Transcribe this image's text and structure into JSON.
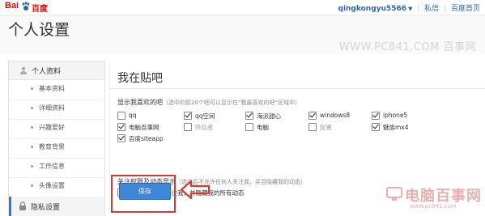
{
  "topbar": {
    "logo_text": "Bai",
    "logo_cn": "百度",
    "username": "qingkongyu5566",
    "links": [
      "私信",
      "百度首页"
    ]
  },
  "header": {
    "title": "个人设置",
    "watermark": "WWW.PC841.COM 百事网"
  },
  "sidebar": {
    "section": "个人资料",
    "items": [
      "基本资料",
      "详细资料",
      "兴趣爱好",
      "教育背景",
      "工作信息",
      "头像设置"
    ],
    "active": "隐私设置"
  },
  "main": {
    "section_title": "我在贴吧",
    "favorites": {
      "label": "显示我喜欢的吧",
      "hint": "（选中的前20个吧可以显示在“我最喜欢的吧”区域中）",
      "options": [
        {
          "label": "qq",
          "checked": false,
          "enabled": true
        },
        {
          "label": "qq空间",
          "checked": true,
          "enabled": true
        },
        {
          "label": "海派甜心",
          "checked": true,
          "enabled": true
        },
        {
          "label": "windows8",
          "checked": true,
          "enabled": true
        },
        {
          "label": "iphone5",
          "checked": true,
          "enabled": true
        },
        {
          "label": "电脑百事网",
          "checked": true,
          "enabled": true
        },
        {
          "label": "降临者",
          "checked": false,
          "enabled": false
        },
        {
          "label": "电脑",
          "checked": false,
          "enabled": true
        },
        {
          "label": "配置",
          "checked": false,
          "enabled": false
        },
        {
          "label": "魅族mx4",
          "checked": true,
          "enabled": true
        },
        {
          "label": "百度siteapp",
          "checked": true,
          "enabled": true
        }
      ]
    },
    "permissions": {
      "label": "关注权限及动态显示",
      "hint": "（选中后不允许任何人关注我，并且隐藏我的动态）",
      "option": "不允许任何人关注我，并隐藏我的所有动态",
      "checked": false
    },
    "save_label": "保存"
  },
  "watermark_logo": {
    "text": "电脑百事网",
    "url": "www.pc841.com"
  },
  "colors": {
    "brand_red": "#e10602",
    "link_blue": "#2d64b3",
    "button_blue": "#3d86d8",
    "highlight_red": "#d53a34"
  }
}
